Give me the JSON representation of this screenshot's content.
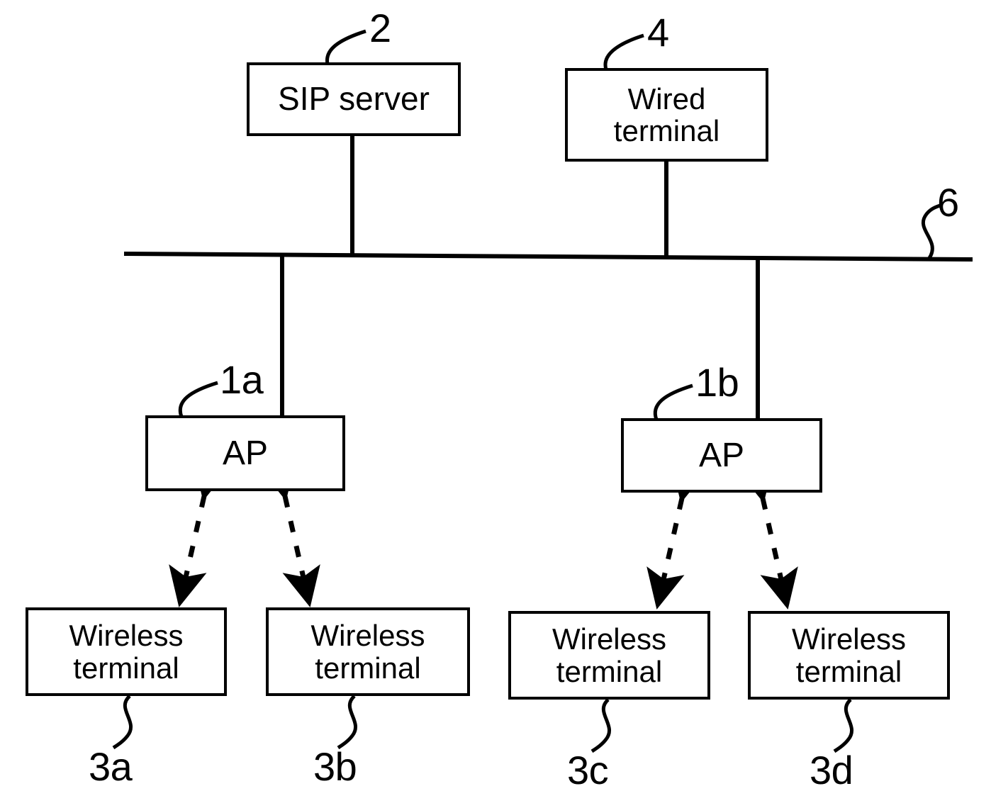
{
  "figure": {
    "kind": "network-topology-diagram",
    "background_color": "#ffffff",
    "stroke_color": "#000000"
  },
  "nodes": {
    "sip_server": {
      "label": "SIP server",
      "lines": [
        "SIP server"
      ],
      "ref": "2"
    },
    "wired_terminal": {
      "label": "Wired terminal",
      "lines": [
        "Wired",
        "terminal"
      ],
      "ref": "4"
    },
    "ap_left": {
      "label": "AP",
      "lines": [
        "AP"
      ],
      "ref": "1a"
    },
    "ap_right": {
      "label": "AP",
      "lines": [
        "AP"
      ],
      "ref": "1b"
    },
    "wireless_terminal_a": {
      "label": "Wireless terminal",
      "lines": [
        "Wireless",
        "terminal"
      ],
      "ref": "3a"
    },
    "wireless_terminal_b": {
      "label": "Wireless terminal",
      "lines": [
        "Wireless",
        "terminal"
      ],
      "ref": "3b"
    },
    "wireless_terminal_c": {
      "label": "Wireless terminal",
      "lines": [
        "Wireless",
        "terminal"
      ],
      "ref": "3c"
    },
    "wireless_terminal_d": {
      "label": "Wireless terminal",
      "lines": [
        "Wireless",
        "terminal"
      ],
      "ref": "3d"
    }
  },
  "network_bus": {
    "ref": "6",
    "description": "wired network bus"
  },
  "connections": [
    {
      "from": "sip_server",
      "to": "network_bus",
      "style": "solid"
    },
    {
      "from": "wired_terminal",
      "to": "network_bus",
      "style": "solid"
    },
    {
      "from": "network_bus",
      "to": "ap_left",
      "style": "solid"
    },
    {
      "from": "network_bus",
      "to": "ap_right",
      "style": "solid"
    },
    {
      "from": "ap_left",
      "to": "wireless_terminal_a",
      "style": "dashed-double-arrow"
    },
    {
      "from": "ap_left",
      "to": "wireless_terminal_b",
      "style": "dashed-double-arrow"
    },
    {
      "from": "ap_right",
      "to": "wireless_terminal_c",
      "style": "dashed-double-arrow"
    },
    {
      "from": "ap_right",
      "to": "wireless_terminal_d",
      "style": "dashed-double-arrow"
    }
  ]
}
